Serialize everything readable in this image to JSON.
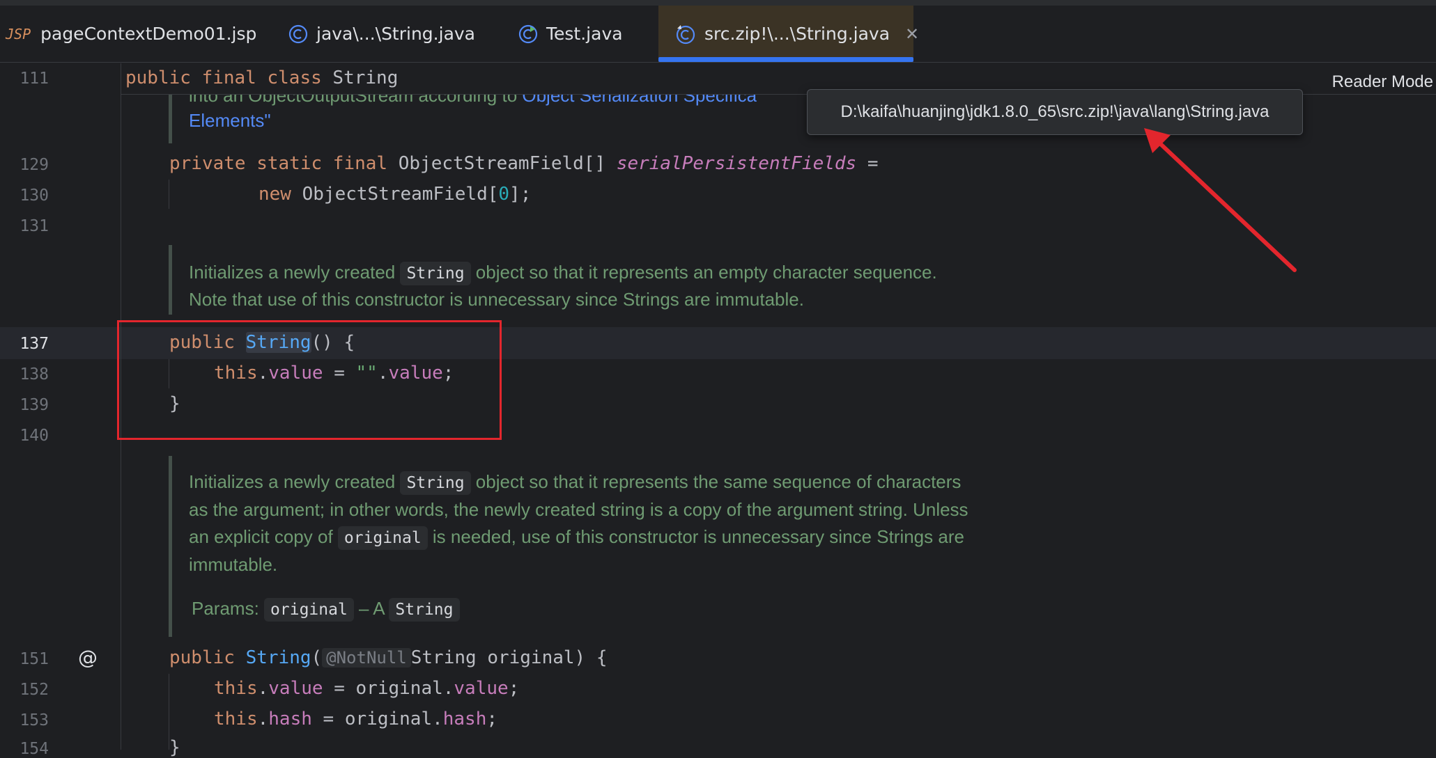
{
  "tabs": [
    {
      "label": "pageContextDemo01.jsp",
      "icon": "jsp-file-icon",
      "icon_text": "JSP"
    },
    {
      "label": "java\\...\\String.java",
      "icon": "class-icon"
    },
    {
      "label": "Test.java",
      "icon": "runnable-class-icon"
    },
    {
      "label": "src.zip!\\...\\String.java",
      "icon": "library-class-icon",
      "active": true
    }
  ],
  "sticky": {
    "line": "111",
    "code_kw": "public final class",
    "code_name": "String"
  },
  "reader_mode": "Reader Mode",
  "tooltip": "D:\\kaifa\\huanjing\\jdk1.8.0_65\\src.zip!\\java\\lang\\String.java",
  "doc0": {
    "text_a": "into an ObjectOutputStream according to ",
    "link": "Object Serialization Specifica",
    "line2": "Elements\""
  },
  "lines": {
    "l129": "129",
    "l130": "130",
    "l131": "131",
    "l137": "137",
    "l138": "138",
    "l139": "139",
    "l140": "140",
    "l151": "151",
    "l152": "152",
    "l153": "153",
    "l154": "154"
  },
  "code": {
    "c129_kw": "private static final",
    "c129_type": " ObjectStreamField[] ",
    "c129_field": "serialPersistentFields",
    "c129_eq": " =",
    "c130_kw": "new",
    "c130_a": " ObjectStreamField[",
    "c130_num": "0",
    "c130_b": "];",
    "c137_kw": "public ",
    "c137_name": "String",
    "c137_rest": "() {",
    "c138_kw": "this",
    "c138_dot": ".",
    "c138_field": "value",
    "c138_eq": " = ",
    "c138_str": "\"\"",
    "c138_dot2": ".",
    "c138_field2": "value",
    "c138_end": ";",
    "c139": "}",
    "c151_kw": "public ",
    "c151_name": "String",
    "c151_paren": "(",
    "c151_ann": "@NotNull",
    "c151_rest": "String original) {",
    "c152_kw": "this",
    "c152_a": ".",
    "c152_field": "value",
    "c152_b": " = original.",
    "c152_field2": "value",
    "c152_end": ";",
    "c153_kw": "this",
    "c153_a": ".",
    "c153_field": "hash",
    "c153_b": " = original.",
    "c153_field2": "hash",
    "c153_end": ";",
    "c154": "}"
  },
  "doc1": {
    "a": "Initializes a newly created ",
    "chip": "String",
    "b": " object so that it represents an empty character sequence.",
    "line2": "Note that use of this constructor is unnecessary since Strings are immutable."
  },
  "doc2": {
    "a": "Initializes a newly created ",
    "chip": "String",
    "b": " object so that it represents the same sequence of characters",
    "line2": "as the argument; in other words, the newly created string is a copy of the argument string. Unless",
    "line3a": "an explicit copy of ",
    "chip2": "original",
    "line3b": " is needed, use of this constructor is unnecessary since Strings are",
    "line4": "immutable.",
    "params_label": "Params: ",
    "param": "original",
    "dash": " – A ",
    "param_type": "String"
  },
  "colors": {
    "accent": "#3574f0",
    "annotation_red": "#e3262d"
  }
}
